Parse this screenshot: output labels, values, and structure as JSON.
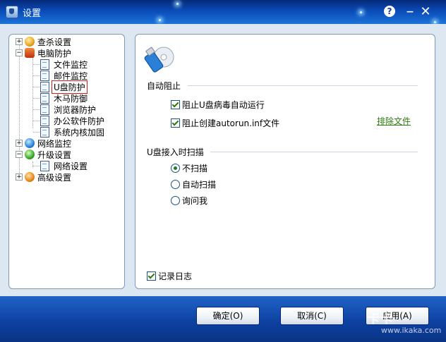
{
  "window": {
    "title": "设置"
  },
  "tree": {
    "items": [
      {
        "label": "查杀设置",
        "expander": "+"
      },
      {
        "label": "电脑防护",
        "expander": "−"
      },
      {
        "label": "文件监控"
      },
      {
        "label": "邮件监控"
      },
      {
        "label": "U盘防护",
        "selected": true
      },
      {
        "label": "木马防御"
      },
      {
        "label": "浏览器防护"
      },
      {
        "label": "办公软件防护"
      },
      {
        "label": "系统内核加固"
      },
      {
        "label": "网络监控",
        "expander": "+"
      },
      {
        "label": "升级设置",
        "expander": "−"
      },
      {
        "label": "网络设置"
      },
      {
        "label": "高级设置",
        "expander": "+"
      }
    ]
  },
  "usb": {
    "auto_block_label": "自动阻止",
    "block_virus_label": "阻止U盘病毒自动运行",
    "block_virus_checked": true,
    "block_autorun_label": "阻止创建autorun.inf文件",
    "block_autorun_checked": true,
    "exclude_files_link": "排除文件",
    "scan_section_label": "U盘接入时扫描",
    "scan_options": [
      {
        "label": "不扫描",
        "checked": true
      },
      {
        "label": "自动扫描",
        "checked": false
      },
      {
        "label": "询问我",
        "checked": false
      }
    ],
    "log_label": "记录日志",
    "log_checked": true
  },
  "buttons": {
    "ok": "确定(O)",
    "cancel": "取消(C)",
    "apply": "应用(A)"
  },
  "watermark": {
    "logo": "卡卡",
    "url": "www.ikaka.com"
  },
  "colors": {
    "titlebar": "#0a4bb8",
    "client_bg": "#dde7f1",
    "link": "#2a7a10",
    "selection_border": "#d21a1a"
  }
}
